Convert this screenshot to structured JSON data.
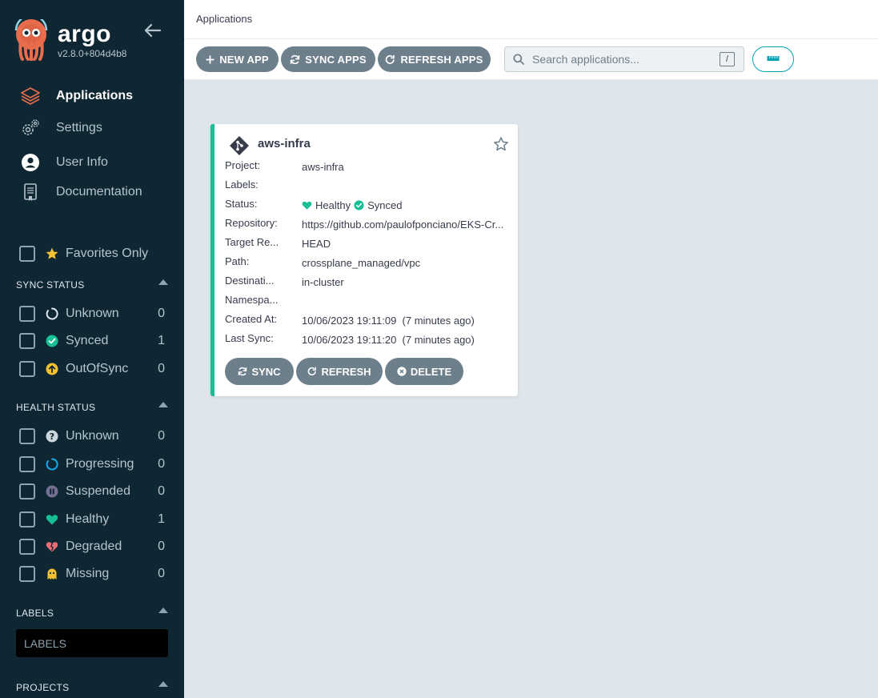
{
  "sidebar": {
    "brand": "argo",
    "version": "v2.8.0+804d4b8",
    "nav": [
      {
        "label": "Applications",
        "icon": "stack-layers-icon",
        "active": true
      },
      {
        "label": "Settings",
        "icon": "gears-icon",
        "active": false
      },
      {
        "label": "User Info",
        "icon": "user-circle-icon",
        "active": false
      },
      {
        "label": "Documentation",
        "icon": "book-icon",
        "active": false
      }
    ],
    "favorites_label": "Favorites Only",
    "sync_status": {
      "title": "SYNC STATUS",
      "items": [
        {
          "label": "Unknown",
          "count": "0"
        },
        {
          "label": "Synced",
          "count": "1"
        },
        {
          "label": "OutOfSync",
          "count": "0"
        }
      ]
    },
    "health_status": {
      "title": "HEALTH STATUS",
      "items": [
        {
          "label": "Unknown",
          "count": "0"
        },
        {
          "label": "Progressing",
          "count": "0"
        },
        {
          "label": "Suspended",
          "count": "0"
        },
        {
          "label": "Healthy",
          "count": "1"
        },
        {
          "label": "Degraded",
          "count": "0"
        },
        {
          "label": "Missing",
          "count": "0"
        }
      ]
    },
    "labels": {
      "title": "LABELS",
      "placeholder": "LABELS"
    },
    "projects": {
      "title": "PROJECTS"
    }
  },
  "topbar": {
    "breadcrumb": "Applications",
    "new_app": "NEW APP",
    "sync_apps": "SYNC APPS",
    "refresh_apps": "REFRESH APPS",
    "search_placeholder": "Search applications...",
    "search_shortcut": "/"
  },
  "app_card": {
    "name": "aws-infra",
    "fields": {
      "project_label": "Project:",
      "project": "aws-infra",
      "labels_label": "Labels:",
      "labels": "",
      "status_label": "Status:",
      "health": "Healthy",
      "sync": "Synced",
      "repository_label": "Repository:",
      "repository": "https://github.com/paulofponciano/EKS-Cr...",
      "target_label": "Target Re...",
      "target": "HEAD",
      "path_label": "Path:",
      "path": "crossplane_managed/vpc",
      "destination_label": "Destinati...",
      "destination": "in-cluster",
      "namespace_label": "Namespa...",
      "namespace": "",
      "created_label": "Created At:",
      "created": "10/06/2023 19:11:09  (7 minutes ago)",
      "last_sync_label": "Last Sync:",
      "last_sync": "10/06/2023 19:11:20  (7 minutes ago)"
    },
    "buttons": {
      "sync": "SYNC",
      "refresh": "REFRESH",
      "delete": "DELETE"
    }
  },
  "colors": {
    "sidebar_bg": "#0f2733",
    "accent_teal": "#18be94",
    "button_gray": "#6d7f8b",
    "healthy": "#18be94",
    "degraded": "#e96d76",
    "progressing": "#0dadea",
    "suspended": "#766f94",
    "missing": "#f4c030",
    "out_of_sync": "#f4c030"
  }
}
